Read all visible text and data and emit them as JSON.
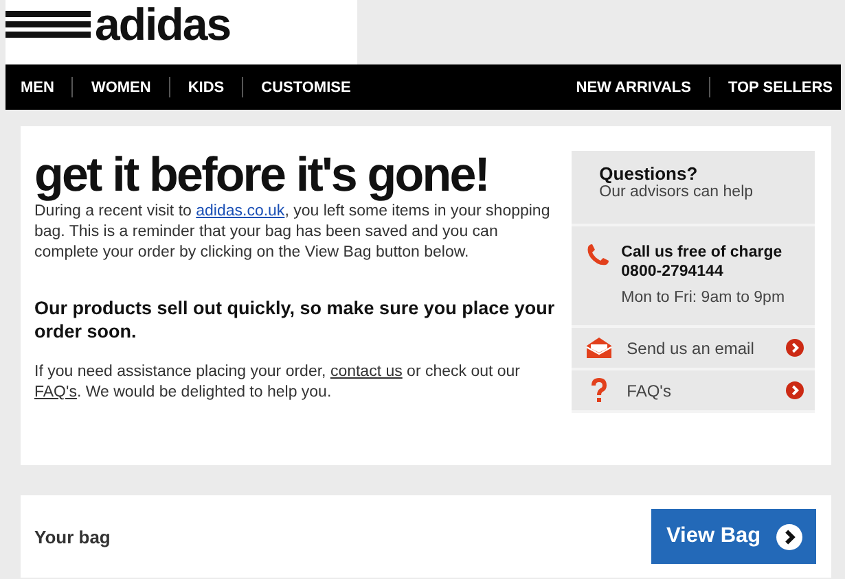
{
  "logo": {
    "text": "adidas"
  },
  "nav": {
    "left": [
      {
        "label": "MEN"
      },
      {
        "label": "WOMEN"
      },
      {
        "label": "KIDS"
      },
      {
        "label": "CUSTOMISE"
      }
    ],
    "right": [
      {
        "label": "NEW ARRIVALS"
      },
      {
        "label": "TOP SELLERS"
      }
    ]
  },
  "message": {
    "headline": "get it before it's gone!",
    "intro": [
      {
        "kind": "text",
        "text": "During a recent visit to "
      },
      {
        "kind": "link",
        "text": "adidas.co.uk"
      },
      {
        "kind": "text",
        "text": ", you left some items in your shopping bag. This is a reminder that your bag has been saved and you can complete your order by clicking on the View Bag button below."
      }
    ],
    "emphasis": "Our products sell out quickly, so make sure you place your order soon.",
    "help": [
      {
        "kind": "text",
        "text": "If you need assistance placing your order, "
      },
      {
        "kind": "underline",
        "text": "contact us"
      },
      {
        "kind": "text",
        "text": " or check out our "
      },
      {
        "kind": "underline",
        "text": "FAQ's"
      },
      {
        "kind": "text",
        "text": ". We would be delighted to help you."
      }
    ]
  },
  "support": {
    "title": "Questions?",
    "subtitle": "Our advisors can help",
    "phone": {
      "title": "Call us free of charge",
      "number": "0800-2794144",
      "hours": "Mon to Fri: 9am to 9pm"
    },
    "links": [
      {
        "kind": "email",
        "label": "Send us an email"
      },
      {
        "kind": "faq",
        "label": "FAQ's"
      }
    ]
  },
  "bag": {
    "title": "Your bag",
    "button": "View Bag"
  }
}
